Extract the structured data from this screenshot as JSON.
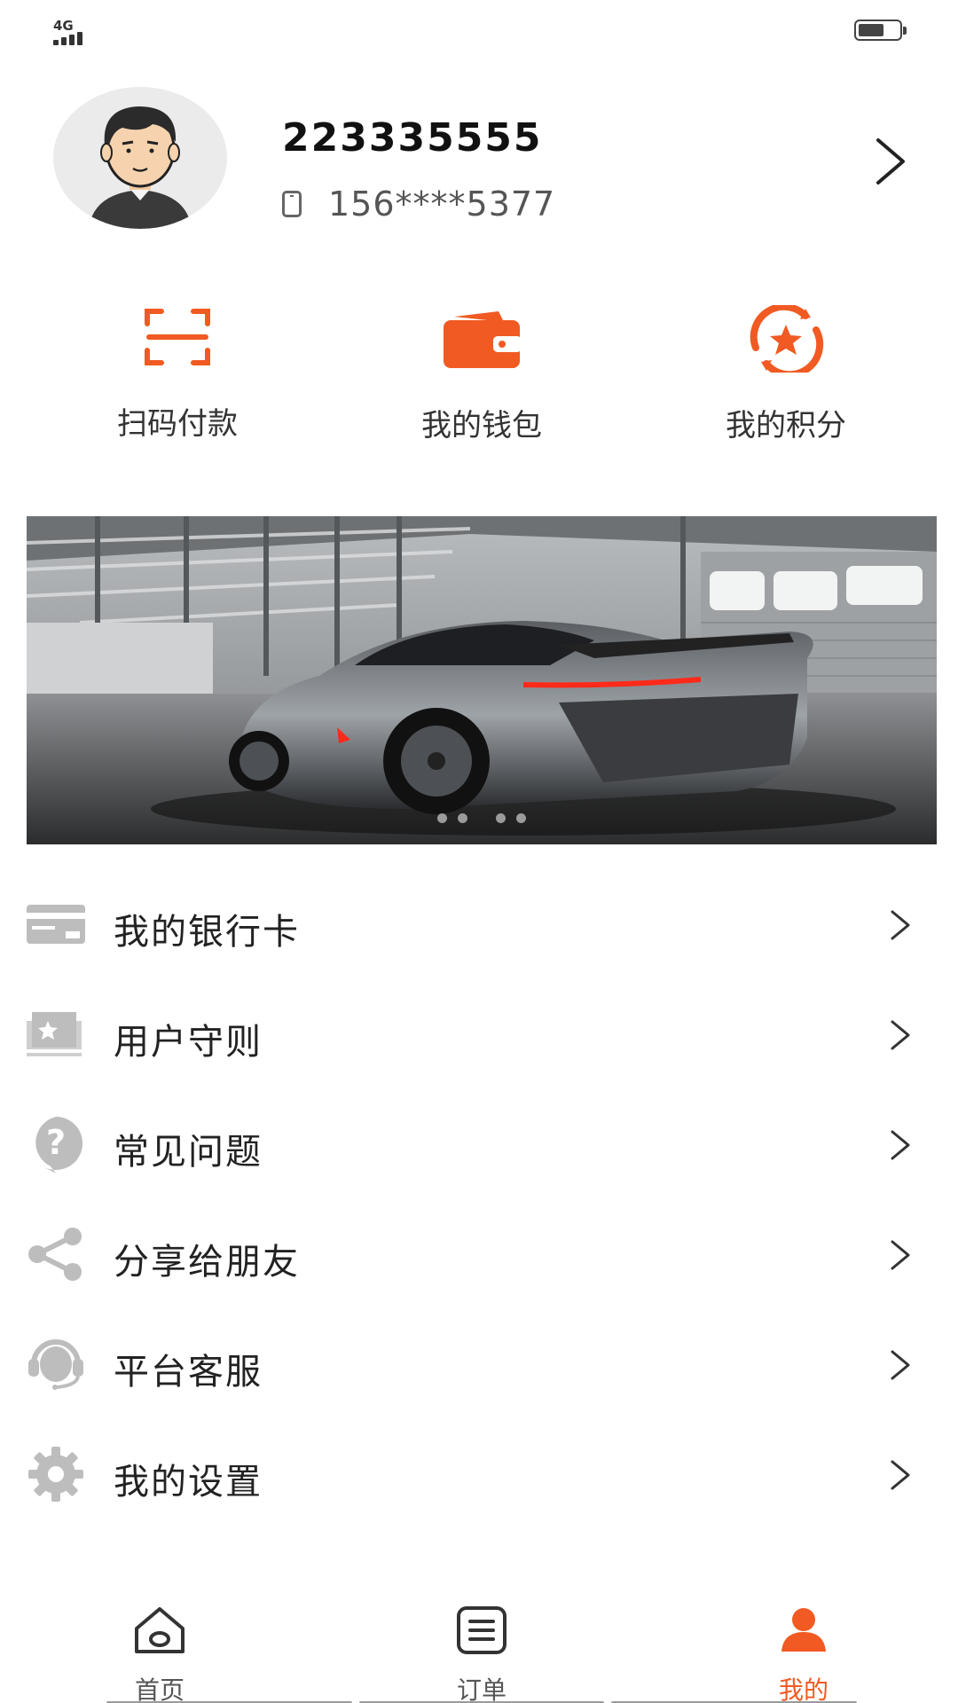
{
  "status_bar": {
    "network": "4G"
  },
  "profile": {
    "name": "223335555",
    "phone": "156****5377"
  },
  "quick_actions": [
    {
      "label": "扫码付款",
      "icon": "scan-icon"
    },
    {
      "label": "我的钱包",
      "icon": "wallet-icon"
    },
    {
      "label": "我的积分",
      "icon": "points-icon"
    }
  ],
  "banner": {
    "image": "sports-car-in-garage",
    "slide_count": 4
  },
  "menu": [
    {
      "label": "我的银行卡",
      "icon": "bank-card-icon"
    },
    {
      "label": "用户守则",
      "icon": "user-rules-icon"
    },
    {
      "label": "常见问题",
      "icon": "faq-icon"
    },
    {
      "label": "分享给朋友",
      "icon": "share-icon"
    },
    {
      "label": "平台客服",
      "icon": "customer-service-icon"
    },
    {
      "label": "我的设置",
      "icon": "settings-icon"
    }
  ],
  "tabs": [
    {
      "label": "首页",
      "icon": "home-icon",
      "active": false
    },
    {
      "label": "订单",
      "icon": "orders-icon",
      "active": false
    },
    {
      "label": "我的",
      "icon": "profile-icon",
      "active": true
    }
  ],
  "colors": {
    "accent": "#f15a22",
    "icon_gray": "#bdbdbd",
    "text": "#222222"
  }
}
